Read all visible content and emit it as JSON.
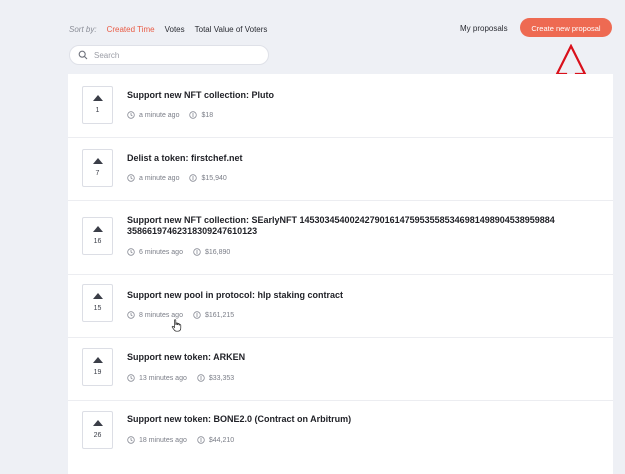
{
  "sort": {
    "label": "Sort by:",
    "options": [
      "Created Time",
      "Votes",
      "Total Value of Voters"
    ],
    "active": "Created Time"
  },
  "header": {
    "my_proposals": "My proposals",
    "create_button": "Create new proposal"
  },
  "search": {
    "placeholder": "Search"
  },
  "proposals": [
    {
      "votes": "1",
      "title": "Support new NFT collection: Pluto",
      "time": "a minute ago",
      "value": "$18"
    },
    {
      "votes": "7",
      "title": "Delist a token: firstchef.net",
      "time": "a minute ago",
      "value": "$15,940"
    },
    {
      "votes": "16",
      "title": "Support new NFT collection: SEarlyNFT 1453034540024279016147595355853469814989045389598843586619746231830924761012​3",
      "time": "6 minutes ago",
      "value": "$16,890"
    },
    {
      "votes": "15",
      "title": "Support new pool in protocol: hlp staking contract",
      "time": "8 minutes ago",
      "value": "$161,215"
    },
    {
      "votes": "19",
      "title": "Support new token: ARKEN",
      "time": "13 minutes ago",
      "value": "$33,353"
    },
    {
      "votes": "26",
      "title": "Support new token: BONE2.0 (Contract on Arbitrum)",
      "time": "18 minutes ago",
      "value": "$44,210"
    }
  ],
  "colors": {
    "accent": "#ee6a52",
    "annotation_arrow": "#d9101b",
    "background": "#eef0f5"
  },
  "icons": [
    "search-icon",
    "upvote-arrow-icon",
    "clock-icon",
    "coin-icon",
    "hand-cursor-icon",
    "annotation-arrow-icon"
  ]
}
